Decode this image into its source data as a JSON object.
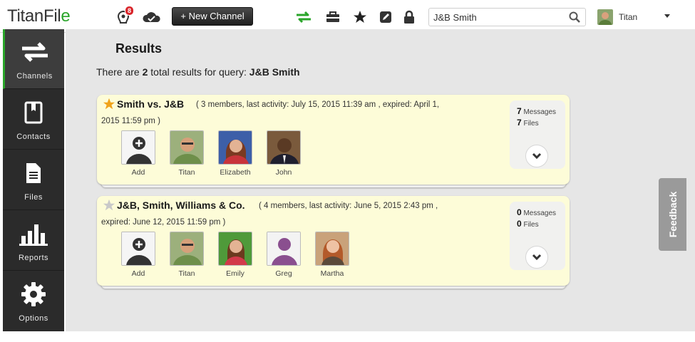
{
  "app": {
    "logo_text": "TitanFil",
    "logo_last": "e"
  },
  "topbar": {
    "notifications_count": "8",
    "new_channel_label": "+ New Channel",
    "search_value": "J&B Smith",
    "user_name": "Titan",
    "icons": [
      "notification-icon",
      "cloud-upload-icon",
      "transfer-arrows-icon",
      "toolbox-icon",
      "star-icon",
      "edit-icon",
      "lock-icon",
      "search-icon"
    ],
    "accent_color": "#2aa52a"
  },
  "sidebar": {
    "items": [
      {
        "label": "Channels",
        "icon": "channels-arrows-icon",
        "active": true
      },
      {
        "label": "Contacts",
        "icon": "contacts-book-icon",
        "active": false
      },
      {
        "label": "Files",
        "icon": "file-icon",
        "active": false
      },
      {
        "label": "Reports",
        "icon": "bar-chart-icon",
        "active": false
      },
      {
        "label": "Options",
        "icon": "gear-icon",
        "active": false
      }
    ]
  },
  "main": {
    "title": "Results",
    "summary_prefix": "There are ",
    "summary_count": "2",
    "summary_middle": " total results for query: ",
    "summary_query": "J&B Smith"
  },
  "channels": [
    {
      "name": "Smith vs. J&B",
      "starred": true,
      "meta_line1": "( 3 members, last activity: July 15, 2015 11:39 am , expired: April 1,",
      "meta_line2": "2015 11:59 pm )",
      "members": [
        "Add",
        "Titan",
        "Elizabeth",
        "John"
      ],
      "messages_count": "7",
      "messages_label": "Messages",
      "files_count": "7",
      "files_label": "Files"
    },
    {
      "name": "J&B, Smith, Williams & Co.",
      "starred": false,
      "meta_line1": "( 4 members, last activity: June 5, 2015 2:43 pm ,",
      "meta_line2": "expired: June 12, 2015 11:59 pm )",
      "members": [
        "Add",
        "Titan",
        "Emily",
        "Greg",
        "Martha"
      ],
      "messages_count": "0",
      "messages_label": "Messages",
      "files_count": "0",
      "files_label": "Files"
    }
  ],
  "feedback_label": "Feedback"
}
